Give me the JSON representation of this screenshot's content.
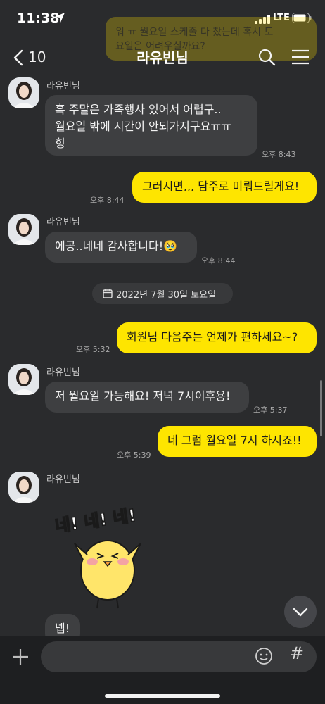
{
  "status_bar": {
    "time": "11:38",
    "network": "LTE"
  },
  "overlay_preview": {
    "text": "워 ㅠ 월요일 스케줄 다 찼는데 혹시 토\n요일은 어려우실까요?"
  },
  "header": {
    "back_count": "10",
    "title": "라유빈님"
  },
  "messages": [
    {
      "sender": "라유빈님",
      "text": "흑 주말은 가족행사 있어서 어렵구..\n월요일 밖에 시간이 안되가지구요ㅠㅠ\n힝",
      "time": "오후 8:43"
    },
    {
      "text": "그러시면,,, 담주로 미뤄드릴게요!",
      "time": "오후 8:44"
    },
    {
      "sender": "라유빈님",
      "text": "에공..네네 감사합니다!🥹",
      "time": "오후 8:44"
    },
    {
      "text": "회원님 다음주는 언제가 편하세요~?",
      "time": "오후 5:32"
    },
    {
      "sender": "라유빈님",
      "text": "저 월요일 가능해요! 저녁 7시이후용!",
      "time": "오후 5:37"
    },
    {
      "text": "네 그럼 월요일 7시 하시죠!!",
      "time": "오후 5:39"
    },
    {
      "sender": "라유빈님",
      "sticker_text": "네! 네! 네!"
    },
    {
      "text": "넵!"
    }
  ],
  "date_divider": "2022년 7월 30일 토요일",
  "input": {
    "value": "",
    "placeholder": ""
  },
  "colors": {
    "background": "#2a2b2d",
    "incoming_bubble": "#3e3f41",
    "outgoing_bubble": "#fee500",
    "accent": "#fee500"
  },
  "icons": [
    "location-arrow-icon",
    "signal-icon",
    "battery-icon",
    "chevron-left-icon",
    "search-icon",
    "menu-icon",
    "calendar-icon",
    "chevron-down-icon",
    "plus-icon",
    "emoji-icon",
    "hash-icon"
  ]
}
